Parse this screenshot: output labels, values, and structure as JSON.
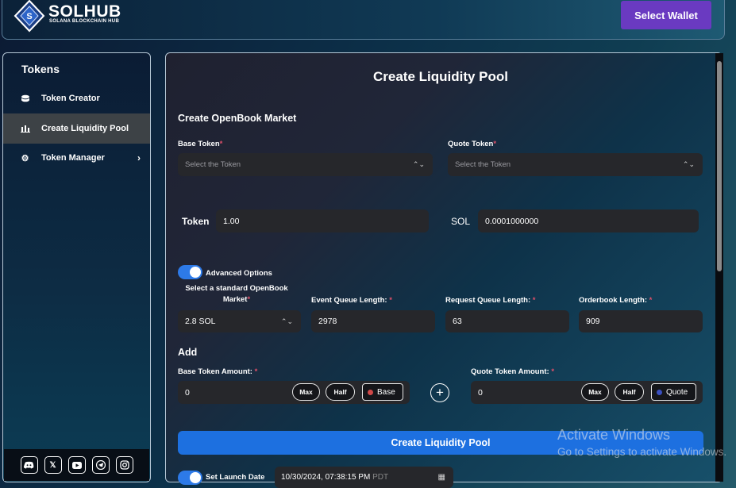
{
  "brand": {
    "name": "SOLHUB",
    "subtitle": "SOLANA BLOCKCHAIN HUB"
  },
  "header": {
    "wallet_button": "Select Wallet"
  },
  "sidebar": {
    "heading": "Tokens",
    "items": [
      {
        "label": "Token Creator",
        "icon": "database-icon"
      },
      {
        "label": "Create Liquidity Pool",
        "icon": "bar-chart-icon",
        "active": true
      },
      {
        "label": "Token Manager",
        "icon": "gear-icon",
        "has_submenu": true
      }
    ],
    "social": [
      "discord-icon",
      "x-icon",
      "youtube-icon",
      "telegram-icon",
      "instagram-icon"
    ]
  },
  "main": {
    "title": "Create Liquidity Pool",
    "market": {
      "heading": "Create OpenBook Market",
      "base_label": "Base Token",
      "base_placeholder": "Select the Token",
      "quote_label": "Quote Token",
      "quote_placeholder": "Select the Token",
      "token_label": "Token",
      "token_value": "1.00",
      "sol_label": "SOL",
      "sol_value": "0.0001000000"
    },
    "advanced": {
      "label": "Advanced Options",
      "enabled": true,
      "market_label_1": "Select a standard OpenBook",
      "market_label_2": "Market",
      "market_value": "2.8 SOL",
      "event_label": "Event Queue Length:",
      "event_value": "2978",
      "request_label": "Request Queue Length:",
      "request_value": "63",
      "orderbook_label": "Orderbook Length:",
      "orderbook_value": "909"
    },
    "add": {
      "heading": "Add",
      "base_amount_label": "Base Token Amount:",
      "base_amount_value": "0",
      "quote_amount_label": "Quote Token Amount:",
      "quote_amount_value": "0",
      "max": "Max",
      "half": "Half",
      "base_tag": "Base",
      "quote_tag": "Quote",
      "base_color": "#d04848",
      "quote_color": "#3a4fc0"
    },
    "create_button": "Create Liquidity Pool",
    "launch": {
      "label": "Set Launch Date",
      "value": "10/30/2024, 07:38:15 PM",
      "tz": "PDT"
    }
  },
  "watermark": {
    "line1": "Activate Windows",
    "line2": "Go to Settings to activate Windows."
  },
  "colors": {
    "accent": "#1d70e0",
    "wallet": "#6a3ac1",
    "required": "#e0506a"
  }
}
